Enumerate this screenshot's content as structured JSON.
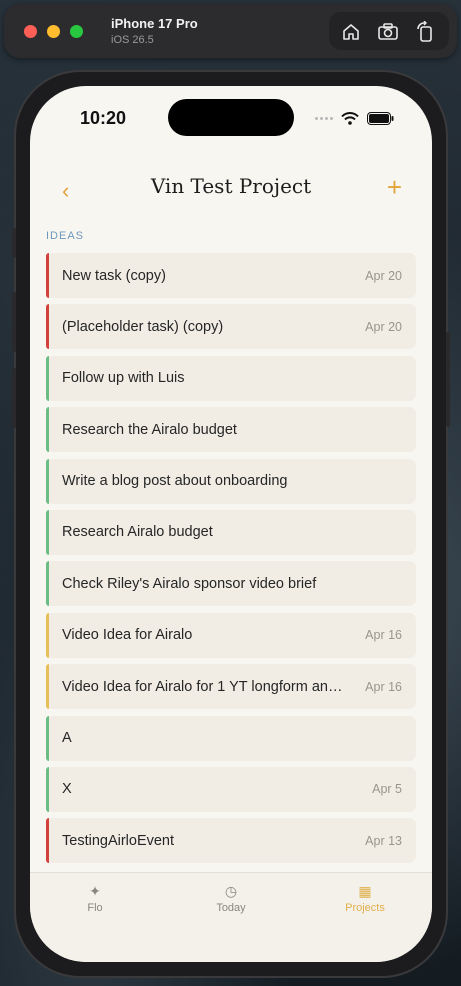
{
  "simulator": {
    "device_name": "iPhone 17 Pro",
    "os_version": "iOS 26.5"
  },
  "status_bar": {
    "time": "10:20"
  },
  "header": {
    "back_glyph": "‹",
    "title": "Vin Test Project",
    "add_glyph": "+"
  },
  "section": {
    "title": "IDEAS"
  },
  "tasks": [
    {
      "label": "New task (copy)",
      "date": "Apr 20",
      "color": "#d2413b"
    },
    {
      "label": "(Placeholder task) (copy)",
      "date": "Apr 20",
      "color": "#d2413b"
    },
    {
      "label": "Follow up with Luis",
      "date": "",
      "color": "#6bbd83"
    },
    {
      "label": "Research the Airalo budget",
      "date": "",
      "color": "#6bbd83"
    },
    {
      "label": "Write a blog post about onboarding",
      "date": "",
      "color": "#6bbd83"
    },
    {
      "label": "Research Airalo budget",
      "date": "",
      "color": "#6bbd83"
    },
    {
      "label": "Check Riley's Airalo sponsor video brief",
      "date": "",
      "color": "#6bbd83"
    },
    {
      "label": "Video Idea for Airalo",
      "date": "Apr 16",
      "color": "#e8c05a"
    },
    {
      "label": "Video Idea for Airalo for 1 YT longform an…",
      "date": "Apr 16",
      "color": "#e8c05a"
    },
    {
      "label": "A",
      "date": "",
      "color": "#6bbd83"
    },
    {
      "label": "X",
      "date": "Apr 5",
      "color": "#6bbd83"
    },
    {
      "label": "TestingAirloEvent",
      "date": "Apr 13",
      "color": "#d2413b"
    }
  ],
  "tabbar": {
    "tabs": [
      {
        "label": "Flo",
        "icon": "sparkle-icon",
        "glyph": "✦"
      },
      {
        "label": "Today",
        "icon": "clock-icon",
        "glyph": "◷"
      },
      {
        "label": "Projects",
        "icon": "grid-icon",
        "glyph": "▦",
        "active": true
      }
    ]
  },
  "colors": {
    "accent": "#e0a43a",
    "section": "#6f98bb",
    "background": "#f8f6f1"
  }
}
